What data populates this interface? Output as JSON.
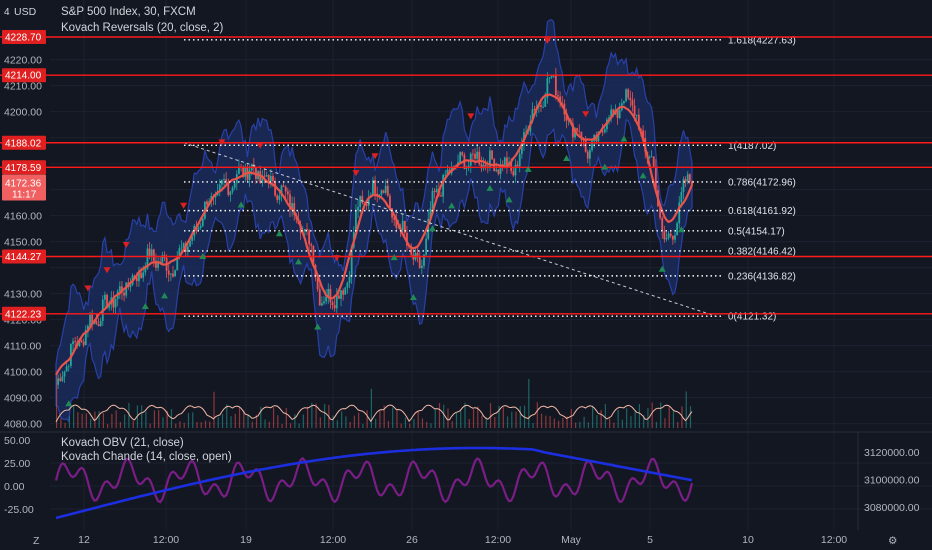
{
  "header": {
    "currency": "USD",
    "title": "S&P 500 Index, 30, FXCM",
    "indicator": "Kovach Reversals (20, close, 2)"
  },
  "lower_pane": {
    "indicator1": "Kovach OBV (21, close)",
    "indicator2": "Kovach Chande (14, close, open)"
  },
  "price_axis": {
    "ticks": [
      "4220.00",
      "4210.00",
      "4200.00",
      "4160.00",
      "4150.00",
      "4130.00",
      "4120.00",
      "4110.00",
      "4100.00",
      "4090.00",
      "4080.00"
    ],
    "tick_values": [
      4220,
      4210,
      4200,
      4160,
      4150,
      4130,
      4120,
      4110,
      4100,
      4090,
      4080
    ],
    "top_clip": "4"
  },
  "price_tags": [
    {
      "text": "4228.70",
      "value": 4228.7
    },
    {
      "text": "4214.00",
      "value": 4214.0
    },
    {
      "text": "4188.02",
      "value": 4188.02
    },
    {
      "text": "4178.59",
      "value": 4178.59
    },
    {
      "text": "4144.27",
      "value": 4144.27
    },
    {
      "text": "4122.23",
      "value": 4122.23
    }
  ],
  "current_price": {
    "price": "4172.36",
    "countdown": "11:17",
    "value": 4172.36
  },
  "fib_levels": [
    {
      "label": "1.618(4227.63)",
      "value": 4227.63
    },
    {
      "label": "1(4187.02)",
      "value": 4187.02
    },
    {
      "label": "0.786(4172.96)",
      "value": 4172.96
    },
    {
      "label": "0.618(4161.92)",
      "value": 4161.92
    },
    {
      "label": "0.5(4154.17)",
      "value": 4154.17
    },
    {
      "label": "0.382(4146.42)",
      "value": 4146.42
    },
    {
      "label": "0.236(4136.82)",
      "value": 4136.82
    },
    {
      "label": "0(4121.32)",
      "value": 4121.32
    }
  ],
  "lower_left_axis": {
    "ticks": [
      "50.00",
      "25.00",
      "0.00",
      "-25.00"
    ],
    "tick_values": [
      50,
      25,
      0,
      -25
    ]
  },
  "lower_right_axis": {
    "ticks": [
      "3120000.00",
      "3100000.00",
      "3080000.00"
    ],
    "tick_values": [
      3120000,
      3100000,
      3080000
    ]
  },
  "time_axis": {
    "labels": [
      "12",
      "12:00",
      "19",
      "12:00",
      "26",
      "12:00",
      "May",
      "5",
      "10",
      "12:00"
    ]
  },
  "corner": {
    "left": "Z",
    "right": "⚙"
  },
  "colors": {
    "background": "#131722",
    "grid": "#1e2230",
    "line_red": "#ff1a1a",
    "tag_red": "#e02020",
    "candle_up": "#26a69a",
    "candle_down": "#ef5350",
    "band": "#1a2b5c",
    "band_edge": "#2940a8",
    "ma": "#e8534a",
    "obv": "#1c2fe0",
    "chande": "#7a1e86",
    "volume_wave": "#f2b8a6",
    "fib": "#ffffff"
  },
  "chart_data": {
    "type": "line",
    "price_range": [
      4076,
      4232
    ],
    "series": [
      {
        "x": [
          0,
          0.03,
          0.06,
          0.09,
          0.12,
          0.15,
          0.18,
          0.21,
          0.24,
          0.27,
          0.3,
          0.33,
          0.36,
          0.39,
          0.42,
          0.45,
          0.48,
          0.51,
          0.54,
          0.57,
          0.6,
          0.63,
          0.66,
          0.69,
          0.72,
          0.75,
          0.78,
          0.81,
          0.84,
          0.87,
          0.9,
          0.93,
          0.96,
          1.0
        ],
        "values": [
          4095,
          4110,
          4120,
          4128,
          4135,
          4144,
          4140,
          4150,
          4165,
          4172,
          4178,
          4174,
          4168,
          4155,
          4128,
          4130,
          4165,
          4172,
          4155,
          4140,
          4170,
          4180,
          4182,
          4180,
          4178,
          4200,
          4212,
          4195,
          4185,
          4198,
          4205,
          4185,
          4150,
          4176
        ]
      }
    ],
    "fib_levels": [
      4227.63,
      4187.02,
      4172.96,
      4161.92,
      4154.17,
      4146.42,
      4136.82,
      4121.32
    ],
    "horizontal_lines": [
      4228.7,
      4214.0,
      4188.02,
      4178.59,
      4144.27,
      4122.23
    ]
  }
}
